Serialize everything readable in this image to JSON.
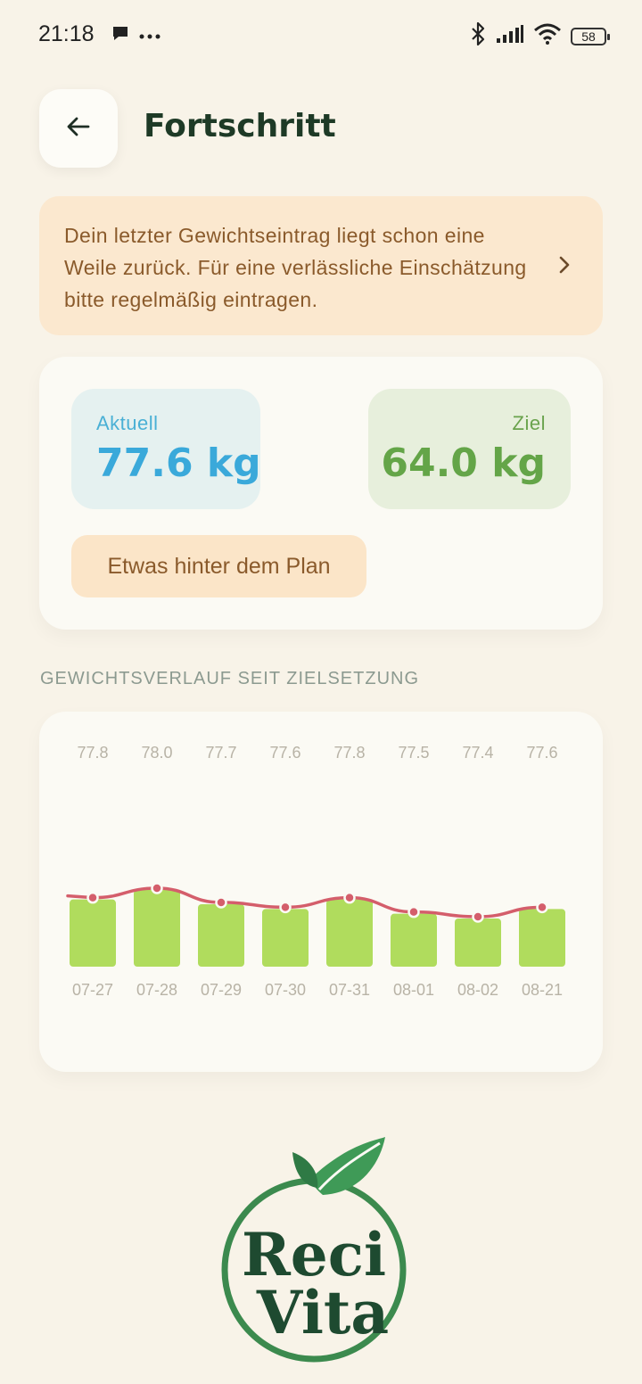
{
  "status_bar": {
    "time": "21:18",
    "battery": "58",
    "icons": [
      "chat-bubble-icon",
      "more-dots-icon",
      "bluetooth-icon",
      "signal-icon",
      "wifi-icon",
      "battery-icon"
    ]
  },
  "header": {
    "title": "Fortschritt",
    "back_icon": "arrow-left-icon"
  },
  "reminder": {
    "text": "Dein letzter Gewichtseintrag liegt schon eine Weile zurück. Für eine verlässliche Einschätzung bitte regelmäßig eintragen.",
    "icon": "chevron-right-icon"
  },
  "stats": {
    "current_label": "Aktuell",
    "current_value": "77.6 kg",
    "goal_label": "Ziel",
    "goal_value": "64.0 kg",
    "plan_status": "Etwas hinter dem Plan"
  },
  "chart_section": {
    "heading": "GEWICHTSVERLAUF SEIT ZIELSETZUNG"
  },
  "chart_data": {
    "type": "bar",
    "categories": [
      "07-27",
      "07-28",
      "07-29",
      "07-30",
      "07-31",
      "08-01",
      "08-02",
      "08-21"
    ],
    "values": [
      77.8,
      78.0,
      77.7,
      77.6,
      77.8,
      77.5,
      77.4,
      77.6
    ],
    "value_labels": [
      "77.8",
      "78.0",
      "77.7",
      "77.6",
      "77.8",
      "77.5",
      "77.4",
      "77.6"
    ],
    "series": [
      {
        "values": [
          77.8,
          78.0,
          77.7,
          77.6,
          77.8,
          77.5,
          77.4,
          77.6
        ]
      }
    ],
    "colors": {
      "bar": "#b0dc5d",
      "line": "#d45e6b",
      "label": "#b8b3a6"
    }
  },
  "logo": {
    "line1": "Reci",
    "line2": "Vita",
    "colors": {
      "ring": "#3c8a4e",
      "text": "#1e4a30",
      "leaf_light": "#3f9a57",
      "leaf_dark": "#2f7a45"
    }
  }
}
